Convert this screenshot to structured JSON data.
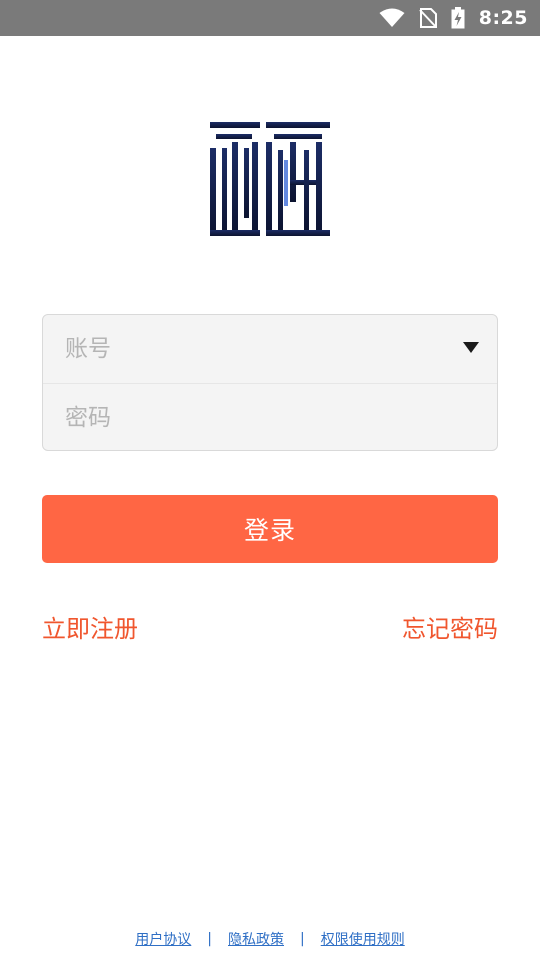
{
  "status_bar": {
    "time": "8:25",
    "icons": [
      "wifi-icon",
      "no-sim-icon",
      "battery-charging-icon"
    ]
  },
  "login_form": {
    "account_placeholder": "账号",
    "password_placeholder": "密码",
    "account_value": "",
    "password_value": ""
  },
  "login_button": {
    "label": "登录"
  },
  "links": {
    "register": "立即注册",
    "forgot_password": "忘记密码"
  },
  "footer": {
    "user_agreement": "用户协议",
    "privacy_policy": "隐私政策",
    "permission_rules": "权限使用规则",
    "separator": "|"
  },
  "colors": {
    "accent": "#ff6644",
    "link_orange": "#f0562e",
    "footer_link": "#2f6fc5",
    "logo_navy": "#14204a",
    "status_bar": "#7a7a7a"
  }
}
